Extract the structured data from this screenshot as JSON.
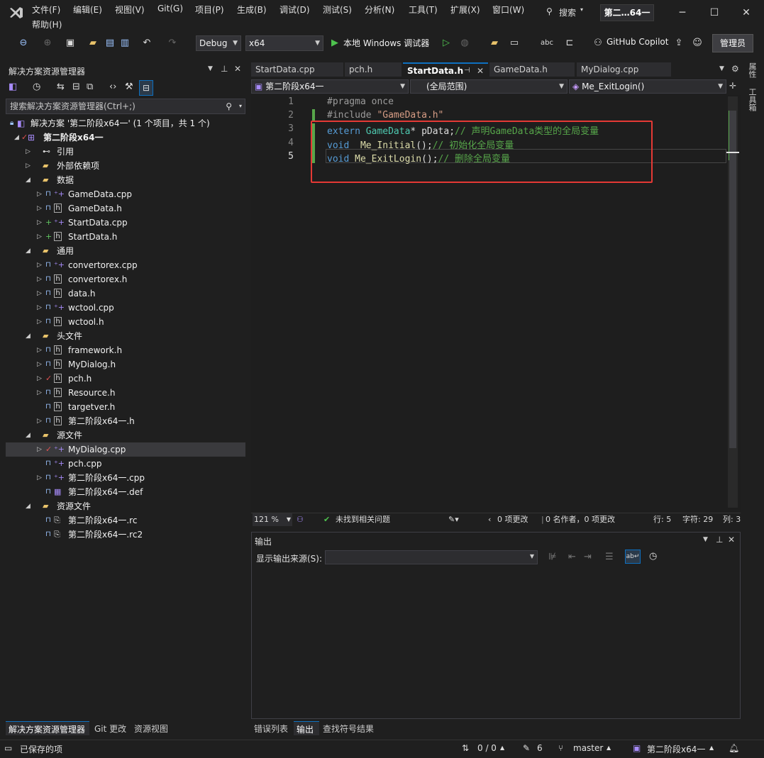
{
  "menu": {
    "items": [
      "文件(F)",
      "编辑(E)",
      "视图(V)",
      "Git(G)",
      "项目(P)",
      "生成(B)",
      "调试(D)",
      "测试(S)",
      "分析(N)",
      "工具(T)",
      "扩展(X)",
      "窗口(W)"
    ],
    "help": "帮助(H)",
    "search": "搜索",
    "solution_title": "第二…64一"
  },
  "toolbar": {
    "config": "Debug",
    "platform": "x64",
    "run_label": "本地 Windows 调试器",
    "copilot": "GitHub Copilot",
    "admin": "管理员"
  },
  "solution_explorer": {
    "title": "解决方案资源管理器",
    "search_placeholder": "搜索解决方案资源管理器(Ctrl+;)",
    "solution_label": "解决方案 '第二阶段x64一' (1 个项目，共 1 个)",
    "project": "第二阶段x64一",
    "rows": [
      "引用",
      "外部依赖项",
      "数据",
      "GameData.cpp",
      "GameData.h",
      "StartData.cpp",
      "StartData.h",
      "通用",
      "convertorex.cpp",
      "convertorex.h",
      "data.h",
      "wctool.cpp",
      "wctool.h",
      "头文件",
      "framework.h",
      "MyDialog.h",
      "pch.h",
      "Resource.h",
      "targetver.h",
      "第二阶段x64一.h",
      "源文件",
      "MyDialog.cpp",
      "pch.cpp",
      "第二阶段x64一.cpp",
      "第二阶段x64一.def",
      "资源文件",
      "第二阶段x64一.rc",
      "第二阶段x64一.rc2"
    ],
    "bottom_tabs": [
      "解决方案资源管理器",
      "Git 更改",
      "资源视图"
    ]
  },
  "editor": {
    "tabs": [
      "StartData.cpp",
      "pch.h",
      "StartData.h",
      "GameData.h",
      "MyDialog.cpp"
    ],
    "nav": [
      "第二阶段x64一",
      "(全局范围)",
      "Me_ExitLogin()"
    ],
    "line_numbers": [
      "1",
      "2",
      "3",
      "4",
      "5"
    ],
    "code": {
      "l1": "#pragma once",
      "l2a": "#include ",
      "l2b": "\"GameData.h\"",
      "l3a": "extern ",
      "l3b": "GameData",
      "l3c": "* pData;",
      "l3d": "// 声明GameData类型的全局变量",
      "l4a": "void",
      "l4b": "  Me_Initial",
      "l4c": "();",
      "l4d": "// 初始化全局变量",
      "l5a": "void",
      "l5b": " Me_ExitLogin",
      "l5c": "();",
      "l5d": "// 删除全局变量"
    },
    "status": {
      "zoom": "121 %",
      "issues": "未找到相关问题",
      "changes": "0 项更改",
      "authors": "0 名作者，0 项更改",
      "line": "行: 5",
      "char": "字符: 29",
      "col": "列: 3"
    }
  },
  "output": {
    "title": "输出",
    "source_label": "显示输出来源(S):",
    "bottom_tabs": [
      "错误列表",
      "输出",
      "查找符号结果"
    ]
  },
  "right_tabs": [
    "属性",
    "工具箱"
  ],
  "statusbar": {
    "saved": "已保存的项",
    "sync": "0 / 0",
    "edits": "6",
    "branch": "master",
    "repo": "第二阶段x64一"
  }
}
